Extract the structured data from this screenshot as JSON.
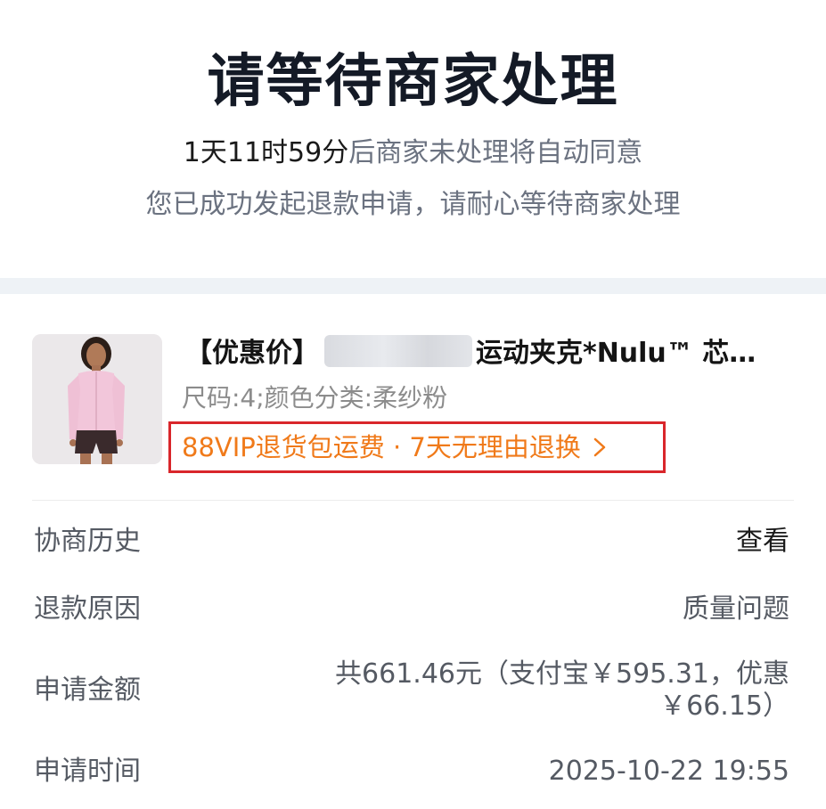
{
  "header": {
    "title": "请等待商家处理",
    "countdown_time": "1天11时59分",
    "countdown_text": "后商家未处理将自动同意",
    "subtitle": "您已成功发起退款申请，请耐心等待商家处理"
  },
  "product": {
    "tag": "【优惠价】",
    "name_visible": "运动夹克*Nulu™ 芯…",
    "spec": "尺码:4;颜色分类:柔纱粉",
    "service": "88VIP退货包运费 · 7天无理由退换",
    "thumbnail_icon": "product-photo-pink-jacket"
  },
  "details": {
    "history_label": "协商历史",
    "history_action": "查看",
    "reason_label": "退款原因",
    "reason_value": "质量问题",
    "amount_label": "申请金额",
    "amount_line1": "共661.46元（支付宝￥595.31，优惠",
    "amount_line2": "￥66.15）",
    "time_label": "申请时间",
    "time_value": "2025-10-22 19:55"
  },
  "colors": {
    "title": "#141a26",
    "muted": "#6b7280",
    "service_orange": "#f07a1a",
    "highlight_red": "#d9262b",
    "section_gap": "#eef2f6"
  }
}
